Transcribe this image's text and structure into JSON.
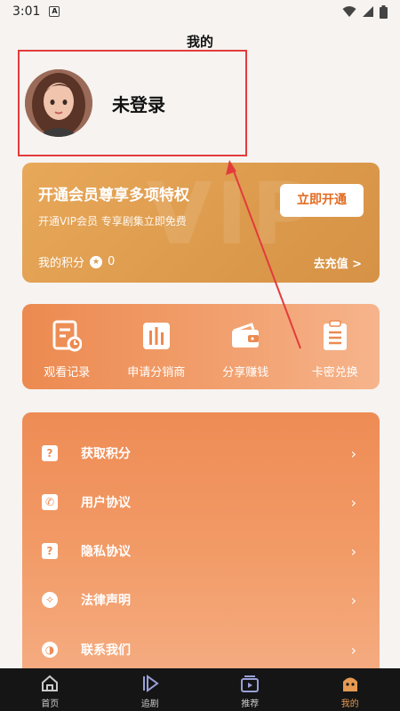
{
  "status_bar": {
    "time": "3:01",
    "notif_letter": "A"
  },
  "header": {
    "title": "我的"
  },
  "profile": {
    "name": "未登录"
  },
  "vip": {
    "watermark": "VIP",
    "title": "开通会员尊享多项特权",
    "subtitle": "开通VIP会员 专享剧集立即免费",
    "button": "立即开通",
    "points_label": "我的积分",
    "points_value": "0",
    "recharge": "去充值 >"
  },
  "actions": [
    {
      "label": "观看记录",
      "icon": "history-icon"
    },
    {
      "label": "申请分销商",
      "icon": "chart-icon"
    },
    {
      "label": "分享赚钱",
      "icon": "wallet-icon"
    },
    {
      "label": "卡密兑换",
      "icon": "clipboard-icon"
    }
  ],
  "menu": [
    {
      "label": "获取积分",
      "icon": "question-icon"
    },
    {
      "label": "用户协议",
      "icon": "phone-icon"
    },
    {
      "label": "隐私协议",
      "icon": "question-icon"
    },
    {
      "label": "法律声明",
      "icon": "bulb-icon"
    },
    {
      "label": "联系我们",
      "icon": "headset-icon"
    }
  ],
  "bottom_nav": [
    {
      "label": "首页",
      "icon": "home-icon"
    },
    {
      "label": "追剧",
      "icon": "play-icon"
    },
    {
      "label": "推荐",
      "icon": "video-icon"
    },
    {
      "label": "我的",
      "icon": "profile-icon",
      "active": true
    }
  ],
  "colors": {
    "accent": "#e36b1f",
    "vip_card": "#dc9a4c",
    "actions_card": "#ec8a50",
    "menu_card": "#ee8c55",
    "annotation_red": "#e33b3b",
    "nav_bg": "#151515",
    "nav_active": "#e59a52"
  }
}
